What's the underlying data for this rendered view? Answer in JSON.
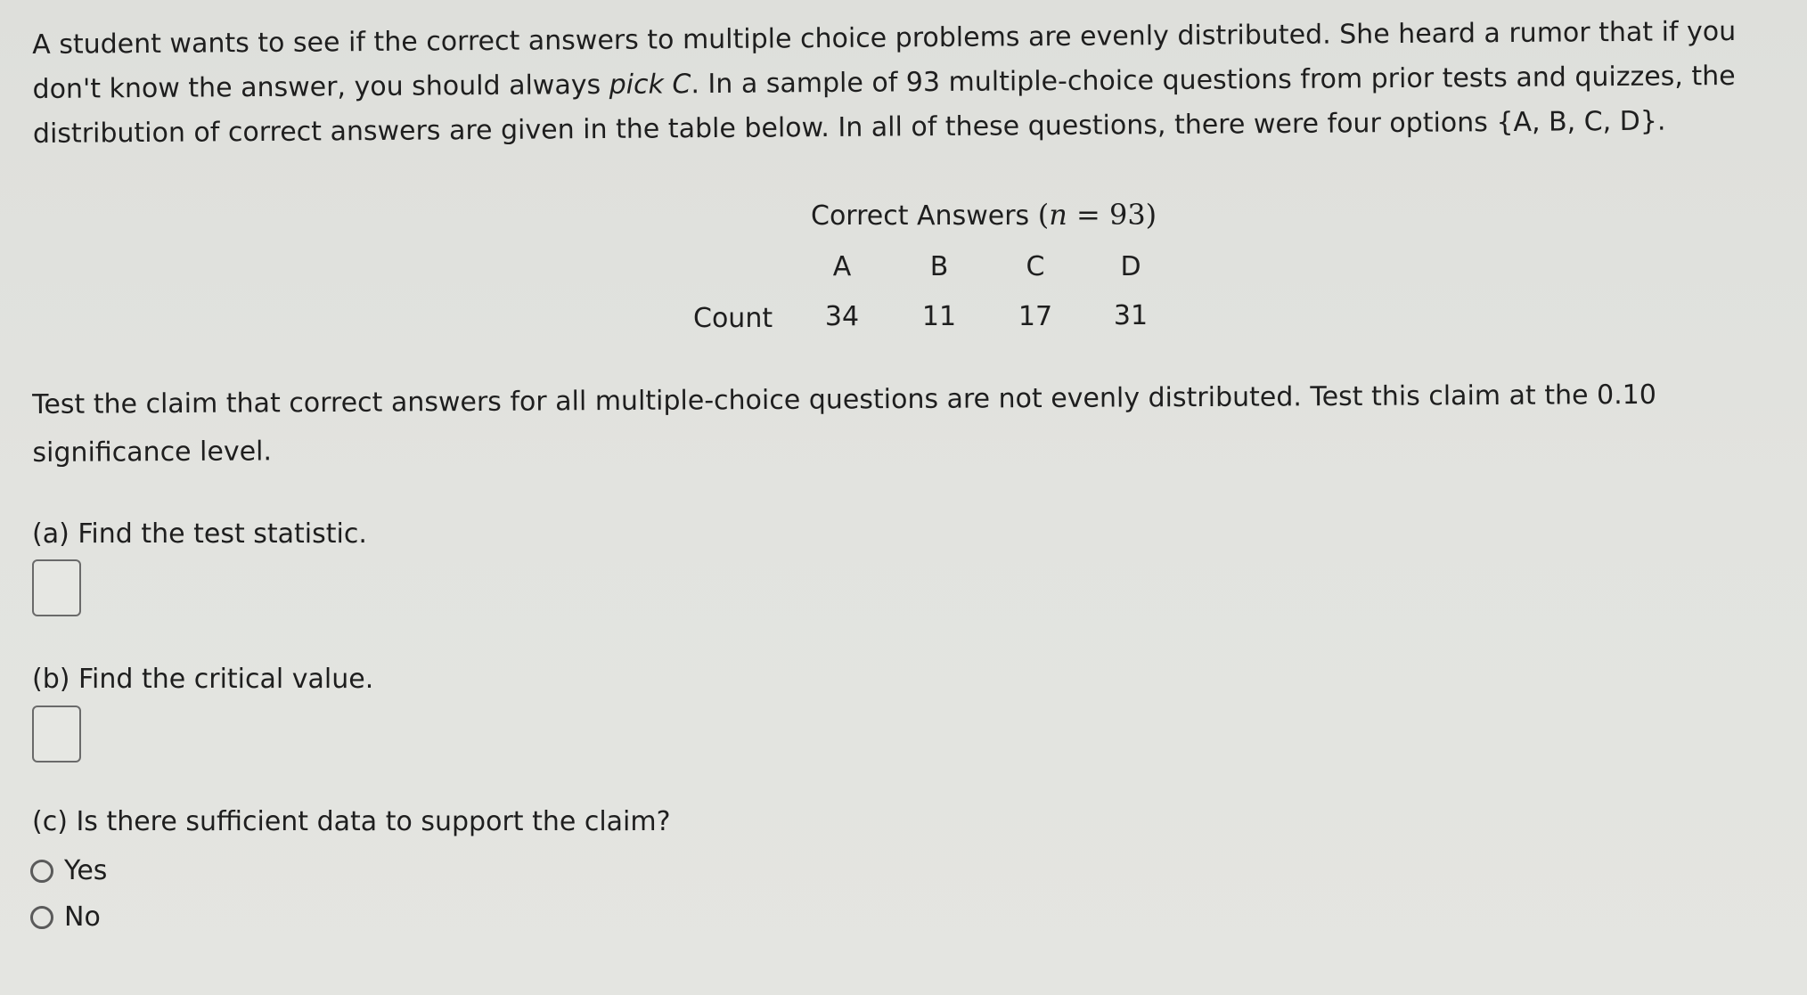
{
  "intro": {
    "line1": "A student wants to see if the correct answers to multiple choice problems are evenly distributed. She heard a rumor that if you",
    "line2_before": "don't know the answer, you should always ",
    "line2_italic": "pick C",
    "line2_after": ". In a sample of 93 multiple-choice questions from prior tests and quizzes, the",
    "line3": "distribution of correct answers are given in the table below. In all of these questions, there were four options {A, B, C, D}."
  },
  "table": {
    "caption_text": "Correct Answers ",
    "caption_math_open": "(",
    "caption_math_var": "n",
    "caption_math_rest": " = 93)",
    "columns": [
      "A",
      "B",
      "C",
      "D"
    ],
    "row_label": "Count",
    "counts": [
      "34",
      "11",
      "17",
      "31"
    ]
  },
  "claim": {
    "line1": "Test the claim that correct answers for all multiple-choice questions are not evenly distributed. Test this claim at the 0.10",
    "line2": "significance level."
  },
  "questions": {
    "a": {
      "label": "(a) Find the test statistic.",
      "value": ""
    },
    "b": {
      "label": "(b) Find the critical value.",
      "value": ""
    },
    "c": {
      "label": "(c) Is there sufficient data to support the claim?",
      "options": [
        "Yes",
        "No"
      ],
      "selected": null
    }
  }
}
